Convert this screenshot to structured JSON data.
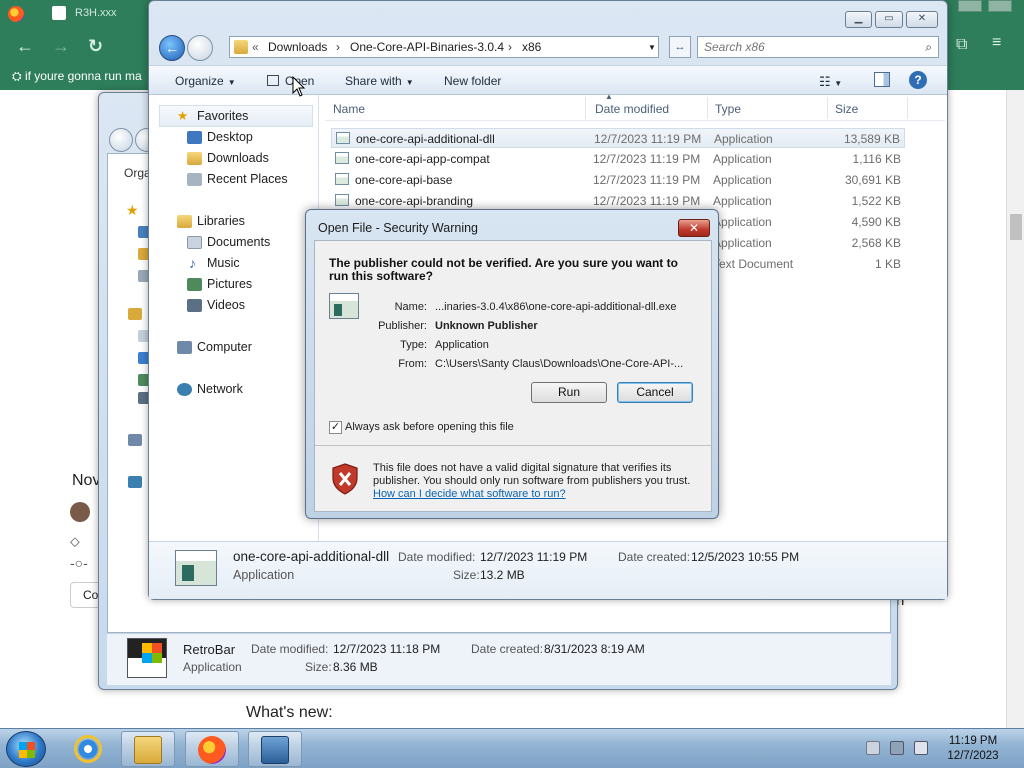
{
  "browser": {
    "tab_title": "R3H.xxx",
    "bookmark": "if youre gonna run ma",
    "page": {
      "heading_fragment": "Nov",
      "whats_new": "What's new:",
      "button_fragment": "Co",
      "side_fragment": "n"
    }
  },
  "back_explorer": {
    "organize_fragment": "Orga",
    "details": {
      "name": "RetroBar",
      "type": "Application",
      "modified_label": "Date modified:",
      "modified": "12/7/2023 11:18 PM",
      "created_label": "Date created:",
      "created": "8/31/2023 8:19 AM",
      "size_label": "Size:",
      "size": "8.36 MB"
    }
  },
  "explorer": {
    "breadcrumb": [
      "Downloads",
      "One-Core-API-Binaries-3.0.4",
      "x86"
    ],
    "search_placeholder": "Search x86",
    "toolbar": {
      "organize": "Organize",
      "open": "Open",
      "share_with": "Share with",
      "new_folder": "New folder"
    },
    "nav": {
      "favorites": "Favorites",
      "desktop": "Desktop",
      "downloads": "Downloads",
      "recent_places": "Recent Places",
      "libraries": "Libraries",
      "documents": "Documents",
      "music": "Music",
      "pictures": "Pictures",
      "videos": "Videos",
      "computer": "Computer",
      "network": "Network"
    },
    "columns": {
      "name": "Name",
      "date_modified": "Date modified",
      "type": "Type",
      "size": "Size"
    },
    "files": [
      {
        "name": "one-core-api-additional-dll",
        "date": "12/7/2023 11:19 PM",
        "type": "Application",
        "size": "13,589 KB"
      },
      {
        "name": "one-core-api-app-compat",
        "date": "12/7/2023 11:19 PM",
        "type": "Application",
        "size": "1,116 KB"
      },
      {
        "name": "one-core-api-base",
        "date": "12/7/2023 11:19 PM",
        "type": "Application",
        "size": "30,691 KB"
      },
      {
        "name": "one-core-api-branding",
        "date": "12/7/2023 11:19 PM",
        "type": "Application",
        "size": "1,522 KB"
      },
      {
        "name": "",
        "date": "",
        "type": "Application",
        "size": "4,590 KB"
      },
      {
        "name": "",
        "date": "",
        "type": "Application",
        "size": "2,568 KB"
      },
      {
        "name": "",
        "date": "",
        "type": "Text Document",
        "size": "1 KB"
      }
    ],
    "details": {
      "name": "one-core-api-additional-dll",
      "type": "Application",
      "modified_label": "Date modified:",
      "modified": "12/7/2023 11:19 PM",
      "created_label": "Date created:",
      "created": "12/5/2023 10:55 PM",
      "size_label": "Size:",
      "size": "13.2 MB"
    }
  },
  "dialog": {
    "title": "Open File - Security Warning",
    "heading": "The publisher could not be verified.  Are you sure you want to run this software?",
    "name_label": "Name:",
    "name": "...inaries-3.0.4\\x86\\one-core-api-additional-dll.exe",
    "publisher_label": "Publisher:",
    "publisher": "Unknown Publisher",
    "type_label": "Type:",
    "type": "Application",
    "from_label": "From:",
    "from": "C:\\Users\\Santy Claus\\Downloads\\One-Core-API-...",
    "run": "Run",
    "cancel": "Cancel",
    "checkbox_label": "Always ask before opening this file",
    "checkbox_checked": true,
    "warning": "This file does not have a valid digital signature that verifies its publisher.  You should only run software from publishers you trust.",
    "link": "How can I decide what software to run?"
  },
  "taskbar": {
    "time": "11:19 PM",
    "date": "12/7/2023"
  },
  "colors": {
    "browser_accent": "#2e7d5b",
    "aero_frame": "#c7d9ec",
    "link": "#0a64b4"
  }
}
